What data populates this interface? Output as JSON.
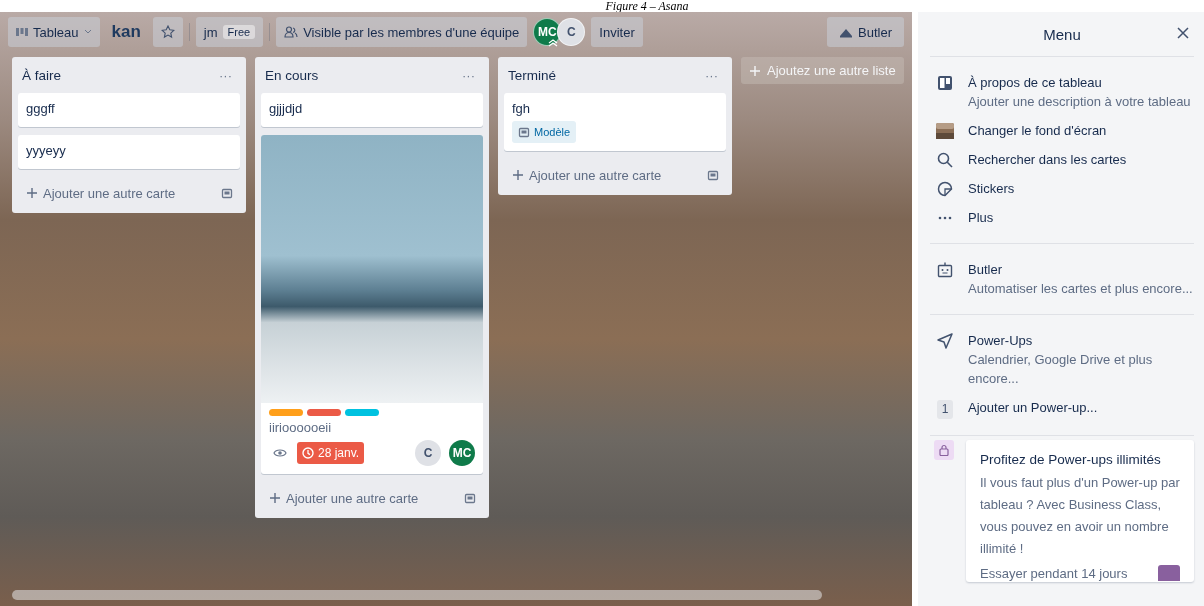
{
  "caption": "Figure 4 – Asana",
  "topbar": {
    "board_menu": "Tableau",
    "board_name": "kan",
    "starred": false,
    "team": "jm",
    "plan": "Free",
    "visibility": "Visible par les membres d'une équipe",
    "members": [
      {
        "initials": "MC",
        "color": "#0f7b4a",
        "admin": true
      },
      {
        "initials": "C",
        "color": "#dfe1e6",
        "admin": false
      }
    ],
    "invite": "Inviter",
    "butler": "Butler"
  },
  "lists": [
    {
      "title": "À faire",
      "menu": "···",
      "add_card": "Ajouter une autre carte",
      "cards": [
        {
          "kind": "plain",
          "title": "gggff"
        },
        {
          "kind": "plain",
          "title": "yyyeyy"
        }
      ]
    },
    {
      "title": "En cours",
      "menu": "···",
      "add_card": "Ajouter une autre carte",
      "cards": [
        {
          "kind": "plain",
          "title": "gjjjdjd"
        },
        {
          "kind": "cover",
          "title": "iirioooooeii",
          "labels": [
            {
              "color": "#ff9f1a"
            },
            {
              "color": "#eb5a46"
            },
            {
              "color": "#00c2e0"
            }
          ],
          "watching": true,
          "due": {
            "text": "28 janv.",
            "overdue": true
          },
          "members": [
            {
              "initials": "C",
              "color": "#dfe1e6"
            },
            {
              "initials": "MC",
              "color": "#0f7b4a"
            }
          ]
        }
      ]
    },
    {
      "title": "Terminé",
      "menu": "···",
      "add_card": "Ajouter une autre carte",
      "cards": [
        {
          "kind": "template",
          "title": "fgh",
          "badge": "Modèle"
        }
      ]
    }
  ],
  "add_list": "Ajoutez une autre liste",
  "menu": {
    "title": "Menu",
    "sections": [
      {
        "items": [
          {
            "title": "À propos de ce tableau",
            "description": "Ajouter une description à votre tableau"
          },
          {
            "title": "Changer le fond d'écran"
          },
          {
            "title": "Rechercher dans les cartes"
          },
          {
            "title": "Stickers"
          },
          {
            "title": "Plus"
          }
        ]
      },
      {
        "items": [
          {
            "title": "Butler",
            "description": "Automatiser les cartes et plus encore..."
          }
        ]
      },
      {
        "items": [
          {
            "title": "Power-Ups",
            "description": "Calendrier, Google Drive et plus encore..."
          },
          {
            "count": "1",
            "title": "Ajouter un Power-up..."
          }
        ]
      }
    ],
    "promo": {
      "title": "Profitez de Power-ups illimités",
      "text": "Il vous faut plus d'un Power-up par tableau ? Avec Business Class, vous pouvez en avoir un nombre illimité !",
      "action": "Essayer pendant 14 jours"
    }
  }
}
